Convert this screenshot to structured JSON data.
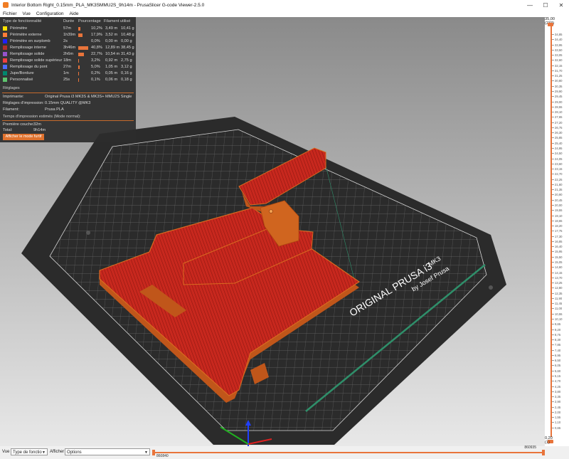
{
  "window": {
    "title": "Interior Bottom Right_0.15mm_PLA_MK3SMMU2S_9h14m - PrusaSlicer G-code Viewer-2.5.0",
    "controls": {
      "minimize": "—",
      "maximize": "☐",
      "close": "✕"
    }
  },
  "menu": [
    "Fichier",
    "Vue",
    "Configuration",
    "Aide"
  ],
  "legend": {
    "headers": {
      "type": "Type de fonctionnalité",
      "time": "Durée",
      "percent": "Pourcentage",
      "filament": "Filament utilisé"
    },
    "rows": [
      {
        "color": "#ffe100",
        "label": "Périmètre",
        "time": "57m",
        "percent": "10,2%",
        "meters": "3,49 m",
        "grams": "10,41 g",
        "fraction": 0.102
      },
      {
        "color": "#ff7d38",
        "label": "Périmètre externe",
        "time": "1h39m",
        "percent": "17,9%",
        "meters": "3,52 m",
        "grams": "10,48 g",
        "fraction": 0.179
      },
      {
        "color": "#1f1fff",
        "label": "Périmètre en surplomb",
        "time": "2s",
        "percent": "0,0%",
        "meters": "0,00 m",
        "grams": "0,00 g",
        "fraction": 0.0
      },
      {
        "color": "#b03029",
        "label": "Remplissage interne",
        "time": "3h46m",
        "percent": "40,8%",
        "meters": "12,89 m",
        "grams": "38,45 g",
        "fraction": 0.408
      },
      {
        "color": "#9654cc",
        "label": "Remplissage solide",
        "time": "2h6m",
        "percent": "22,7%",
        "meters": "10,54 m",
        "grams": "31,43 g",
        "fraction": 0.227
      },
      {
        "color": "#f04040",
        "label": "Remplissage solide supérieur",
        "time": "18m",
        "percent": "3,2%",
        "meters": "0,92 m",
        "grams": "2,75 g",
        "fraction": 0.032
      },
      {
        "color": "#4d6bff",
        "label": "Remplissage du pont",
        "time": "27m",
        "percent": "5,0%",
        "meters": "1,05 m",
        "grams": "3,12 g",
        "fraction": 0.05
      },
      {
        "color": "#00876e",
        "label": "Jupe/Bordure",
        "time": "1m",
        "percent": "0,2%",
        "meters": "0,05 m",
        "grams": "0,16 g",
        "fraction": 0.002
      },
      {
        "color": "#5ec46e",
        "label": "Personnalisé",
        "time": "25s",
        "percent": "0,1%",
        "meters": "0,06 m",
        "grams": "0,18 g",
        "fraction": 0.001
      }
    ],
    "settings_title": "Réglages",
    "printer_label": "Imprimante:",
    "printer_value": "Original Prusa i3 MK3S & MK3S+ MMU2S Single",
    "print_label": "Réglages d'impression:",
    "print_value": "0.15mm QUALITY @MK3",
    "filament_label": "Filament:",
    "filament_value": "Prusa PLA",
    "time_title": "Temps d'impression estimés (Mode normal):",
    "first_layer_label": "Première couche:",
    "first_layer_value": "32m",
    "total_label": "Total:",
    "total_value": "9h14m",
    "stealth_button": "Afficher le mode furtif"
  },
  "bed": {
    "brand": "ORIGINAL PRUSA i3",
    "model": "MK3",
    "by": "by Josef Prusa"
  },
  "colors": {
    "infill": "#c8281e",
    "perimeter": "#e07020",
    "bed": "#2e2e2e",
    "accent": "#e8743b"
  },
  "layers": {
    "top_height": "35,00",
    "top_index": "(233)",
    "bottom_height": "0,20",
    "bottom_index": "(1)",
    "ticks": [
      "34,85",
      "34,40",
      "33,95",
      "33,50",
      "33,05",
      "32,60",
      "32,15",
      "31,70",
      "31,25",
      "30,80",
      "30,35",
      "29,90",
      "29,45",
      "29,00",
      "28,55",
      "28,10",
      "27,65",
      "27,20",
      "26,75",
      "26,30",
      "25,85",
      "25,40",
      "24,95",
      "24,50",
      "24,05",
      "23,60",
      "23,15",
      "22,70",
      "22,25",
      "21,80",
      "21,35",
      "20,90",
      "20,45",
      "20,00",
      "19,55",
      "19,10",
      "18,65",
      "18,20",
      "17,75",
      "17,30",
      "16,85",
      "16,40",
      "15,95",
      "15,50",
      "15,05",
      "14,60",
      "14,15",
      "13,70",
      "13,25",
      "12,80",
      "12,35",
      "11,90",
      "11,45",
      "11,00",
      "10,55",
      "10,10",
      "9,65",
      "9,20",
      "8,75",
      "8,30",
      "7,85",
      "7,40",
      "6,95",
      "6,50",
      "6,05",
      "5,60",
      "5,15",
      "4,70",
      "4,25",
      "3,80",
      "3,35",
      "2,90",
      "2,45",
      "2,00",
      "1,55",
      "1,10",
      "0,65"
    ]
  },
  "bottom": {
    "view_label": "Vue",
    "view_value": "Type de fonctio",
    "show_label": "Afficher",
    "show_value": "Options",
    "moves_end": "860935",
    "moves_start": "860840"
  }
}
